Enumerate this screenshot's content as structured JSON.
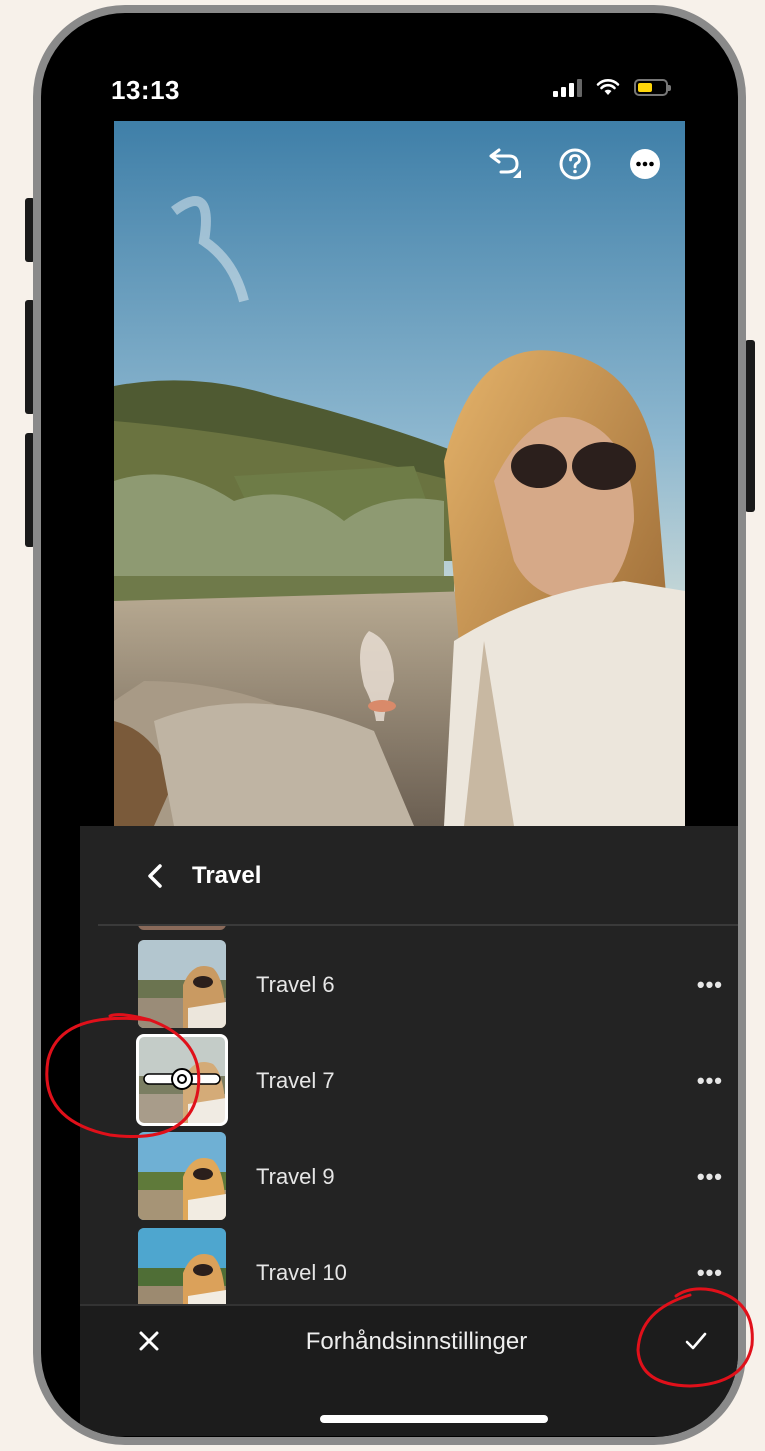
{
  "status_bar": {
    "time": "13:13"
  },
  "panel": {
    "title": "Travel"
  },
  "presets": [
    {
      "label": "Travel 6",
      "more": "•••"
    },
    {
      "label": "Travel 7",
      "more": "•••"
    },
    {
      "label": "Travel 9",
      "more": "•••"
    },
    {
      "label": "Travel 10",
      "more": "•••"
    }
  ],
  "bottom_bar": {
    "title": "Forhåndsinnstillinger"
  },
  "colors": {
    "background": "#f7f1ea",
    "panel": "#232323",
    "battery": "#ffd60a",
    "annotation": "#e0101a"
  },
  "icons": [
    "undo-icon",
    "help-icon",
    "more-icon",
    "back-chevron-icon",
    "close-icon",
    "checkmark-icon",
    "slider-icon"
  ]
}
